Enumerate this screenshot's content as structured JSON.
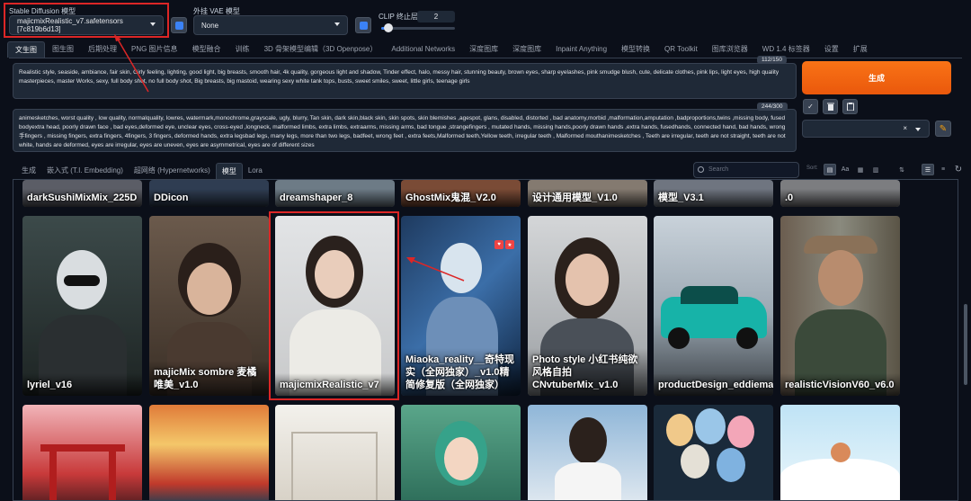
{
  "top_bar": {
    "sd_model_label": "Stable Diffusion 模型",
    "sd_model_value": "majicmixRealistic_v7.safetensors [7c819b6d13]",
    "vae_label": "外挂 VAE 模型",
    "vae_value": "None",
    "clip_label": "CLIP 终止层数",
    "clip_value": "2",
    "clip_fraction": 0.1
  },
  "main_tabs": [
    "文生图",
    "图生图",
    "后期处理",
    "PNG 图片信息",
    "模型融合",
    "训练",
    "3D 骨架模型编辑（3D Openpose）",
    "Additional Networks",
    "深度图库",
    "深度图库",
    "Inpaint Anything",
    "模型转换",
    "QR Toolkit",
    "图库浏览器",
    "WD 1.4 标签器",
    "设置",
    "扩展"
  ],
  "prompt": {
    "positive": "Realistic style, seaside, ambiance, fair skin, Girly feeling, lighting, good light, big breasts, smooth hair, 4k quality, gorgeous light and shadow, Tinder effect, halo, messy hair, stunning beauty, brown eyes, sharp eyelashes, pink smudge blush, cute, delicate clothes, pink lips, light eyes, high quality masterpieces, master Works, sexy, full body shot, no full body shot, Big breasts, big mastoid, wearing sexy white tank tops, busts, sweet smiles, sweet, little girls, teenage girls",
    "positive_count": "112/150",
    "negative": "animesketches, worst quality , low quality, normalquality, lowres, watermark,monochrome,grayscale, ugly, blurry, Tan skin, dark skin,black skin, skin spots, skin blemishes ,agespot, glans, disabled, distorted , bad anatomy,morbid ,malformation,amputation ,badproportions,twins ,missing body, fused bodyextra head, poorly drawn face , bad eyes,deformed eye, unclear eyes, cross-eyed ,longneck, malformed limbs, extra limbs, extraarms, missing arms, bad tongue ,strangefingers , mutated hands, missing hands,poorly drawn hands ,extra hands, fusedhands, connected hand, bad hands, wrong手fingers , missing fingers, extra fingers, 4fingers, 3 fingers, deformed hands, extra legsbad legs, many legs, more than two legs, badfeet, wrong feet , extra feets,Malformed teeth,Yellow teeth,   irregular teeth ,   Malformed mouthanimesketches ,  Teeth are irregular, teeth are not straight, teeth are not white, hands are deformed, eyes are irregular, eyes are uneven, eyes are asymmetrical, eyes are of different sizes",
    "negative_count": "244/300"
  },
  "right_panel": {
    "generate_label": "生成",
    "style_clear": "×"
  },
  "extra_networks": {
    "tabs": [
      "生成",
      "嵌入式 (T.I. Embedding)",
      "超网络 (Hypernetworks)",
      "模型",
      "Lora"
    ],
    "active_tab": 3,
    "search_placeholder": "Search",
    "sort_label": "Sort:"
  },
  "cards_top": [
    "darkSushiMixMix_225D",
    "DDicon",
    "dreamshaper_8",
    "GhostMix鬼混_V2.0",
    "设计通用模型_V1.0",
    "模型_V3.1",
    ".0"
  ],
  "cards_mid": [
    "lyriel_v16",
    "majicMix sombre 麦橘唯美_v1.0",
    "majicmixRealistic_v7",
    "Miaoka_reality__奇特现实（全网独家）_v1.0精简修复版（全网独家）",
    "Photo style 小红书纯欲风格自拍 CNvtuberMix_v1.0",
    "productDesign_eddiemauro20",
    "realisticVisionV60_v6.0"
  ],
  "colors": {
    "accent": "#ea580c",
    "highlight": "#dc2626",
    "blue": "#3b82f6"
  }
}
